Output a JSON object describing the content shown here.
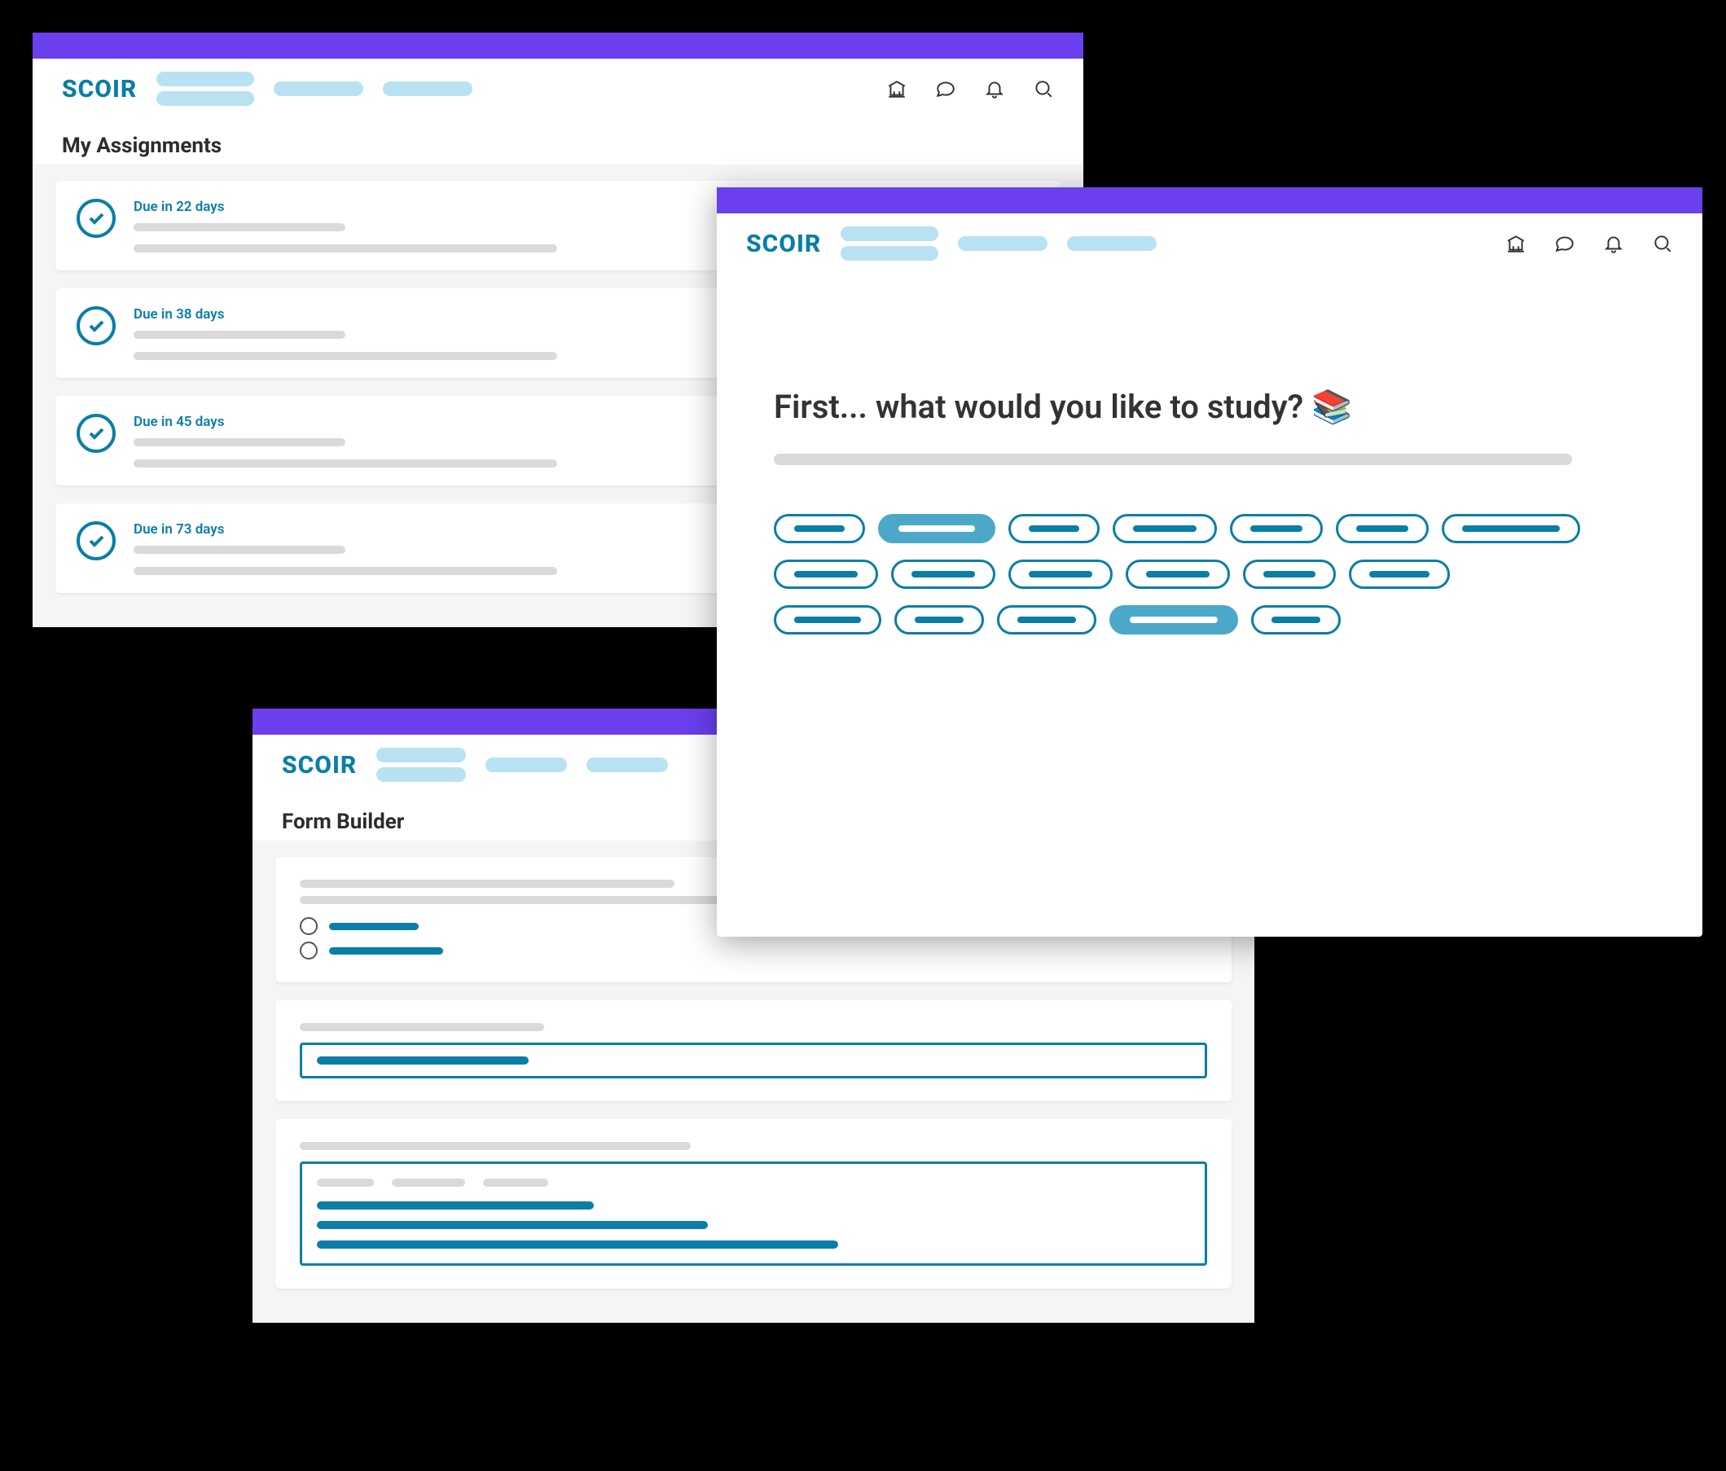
{
  "brand": "SCOIR",
  "assignments": {
    "title": "My Assignments",
    "items": [
      {
        "due": "Due in 22 days"
      },
      {
        "due": "Due in 38 days"
      },
      {
        "due": "Due in 45 days"
      },
      {
        "due": "Due in 73 days"
      }
    ]
  },
  "formBuilder": {
    "title": "Form Builder"
  },
  "studyPrompt": {
    "title": "First... what would you like to study? 📚",
    "chips": {
      "row1": [
        {
          "w": 62,
          "selected": false
        },
        {
          "w": 94,
          "selected": true
        },
        {
          "w": 62,
          "selected": false
        },
        {
          "w": 78,
          "selected": false
        },
        {
          "w": 64,
          "selected": false
        },
        {
          "w": 64,
          "selected": false
        },
        {
          "w": 120,
          "selected": false
        }
      ],
      "row2": [
        {
          "w": 78,
          "selected": false
        },
        {
          "w": 78,
          "selected": false
        },
        {
          "w": 78,
          "selected": false
        },
        {
          "w": 78,
          "selected": false
        },
        {
          "w": 64,
          "selected": false
        },
        {
          "w": 74,
          "selected": false
        }
      ],
      "row3": [
        {
          "w": 82,
          "selected": false
        },
        {
          "w": 60,
          "selected": false
        },
        {
          "w": 72,
          "selected": false
        },
        {
          "w": 108,
          "selected": true
        },
        {
          "w": 60,
          "selected": false
        }
      ]
    }
  }
}
